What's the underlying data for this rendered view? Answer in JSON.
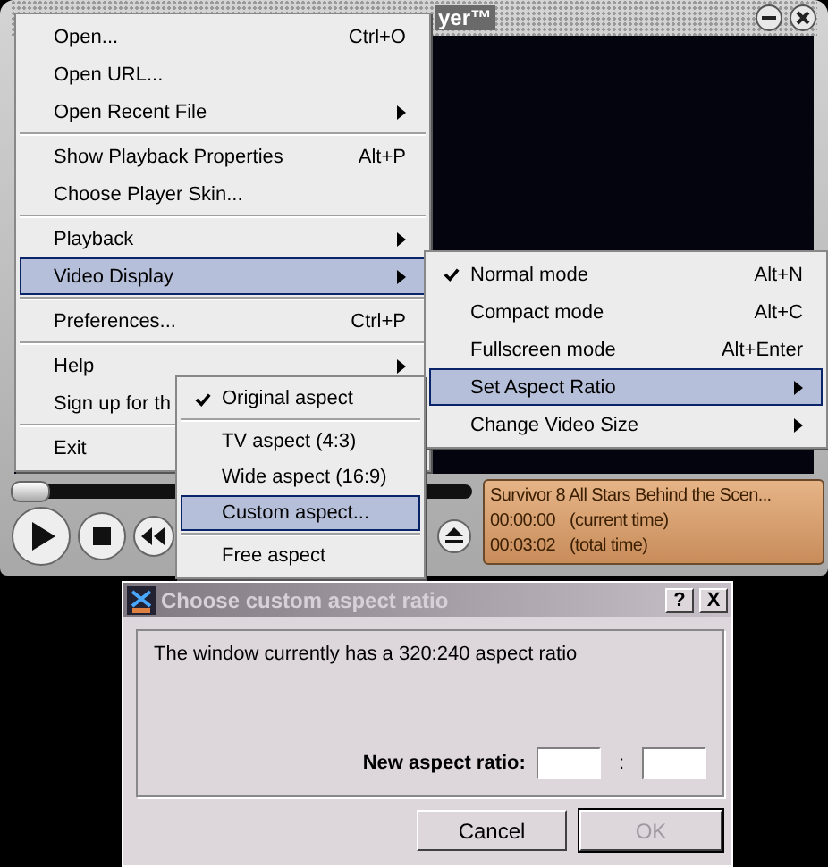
{
  "player": {
    "title": "yer™",
    "seek": {
      "level": 0
    },
    "info": {
      "title": "Survivor 8 All Stars Behind the Scen...",
      "lines": [
        {
          "time": "00:00:00",
          "note": "(current time)"
        },
        {
          "time": "00:03:02",
          "note": "(total time)"
        }
      ]
    }
  },
  "menu": {
    "items": [
      {
        "kind": "item",
        "label": "Open...",
        "shortcut": "Ctrl+O",
        "submenu": false,
        "selected": false
      },
      {
        "kind": "item",
        "label": "Open URL...",
        "submenu": false,
        "selected": false
      },
      {
        "kind": "item",
        "label": "Open Recent File",
        "submenu": true,
        "selected": false
      },
      {
        "kind": "separator"
      },
      {
        "kind": "item",
        "label": "Show Playback Properties",
        "shortcut": "Alt+P",
        "submenu": false,
        "selected": false
      },
      {
        "kind": "item",
        "label": "Choose Player Skin...",
        "submenu": false,
        "selected": false
      },
      {
        "kind": "separator"
      },
      {
        "kind": "item",
        "label": "Playback",
        "submenu": true,
        "selected": false
      },
      {
        "kind": "item",
        "label": "Video Display",
        "submenu": true,
        "selected": true
      },
      {
        "kind": "separator"
      },
      {
        "kind": "item",
        "label": "Preferences...",
        "shortcut": "Ctrl+P",
        "submenu": false,
        "selected": false
      },
      {
        "kind": "separator"
      },
      {
        "kind": "item",
        "label": "Help",
        "submenu": true,
        "selected": false
      },
      {
        "kind": "item",
        "label": "Sign up for th",
        "selected": false
      },
      {
        "kind": "separator"
      },
      {
        "kind": "item",
        "label": "Exit",
        "selected": false
      }
    ]
  },
  "video_display_menu": {
    "items": [
      {
        "kind": "item",
        "label": "Normal mode",
        "shortcut": "Alt+N",
        "checked": true,
        "submenu": false,
        "selected": false
      },
      {
        "kind": "item",
        "label": "Compact mode",
        "shortcut": "Alt+C",
        "checked": false,
        "submenu": false,
        "selected": false
      },
      {
        "kind": "item",
        "label": "Fullscreen mode",
        "shortcut": "Alt+Enter",
        "checked": false,
        "submenu": false,
        "selected": false
      },
      {
        "kind": "item",
        "label": "Set Aspect Ratio",
        "checked": false,
        "submenu": true,
        "selected": true
      },
      {
        "kind": "item",
        "label": "Change Video Size",
        "checked": false,
        "submenu": true,
        "selected": false
      }
    ]
  },
  "aspect_menu": {
    "items": [
      {
        "kind": "item",
        "label": "Original aspect",
        "checked": true,
        "selected": false
      },
      {
        "kind": "separator"
      },
      {
        "kind": "item",
        "label": "TV aspect (4:3)",
        "checked": false,
        "selected": false
      },
      {
        "kind": "item",
        "label": "Wide aspect (16:9)",
        "checked": false,
        "selected": false
      },
      {
        "kind": "item",
        "label": "Custom aspect...",
        "checked": false,
        "selected": true
      },
      {
        "kind": "separator"
      },
      {
        "kind": "item",
        "label": "Free aspect",
        "checked": false,
        "selected": false
      }
    ]
  },
  "dialog": {
    "title": "Choose custom aspect ratio",
    "help": "?",
    "close": "X",
    "message": "The window currently has a 320:240 aspect ratio",
    "ratio_label": "New aspect ratio:",
    "ratio_separator": ":",
    "buttons": [
      {
        "label": "Cancel",
        "disabled": false
      },
      {
        "label": "OK",
        "disabled": true
      }
    ]
  }
}
